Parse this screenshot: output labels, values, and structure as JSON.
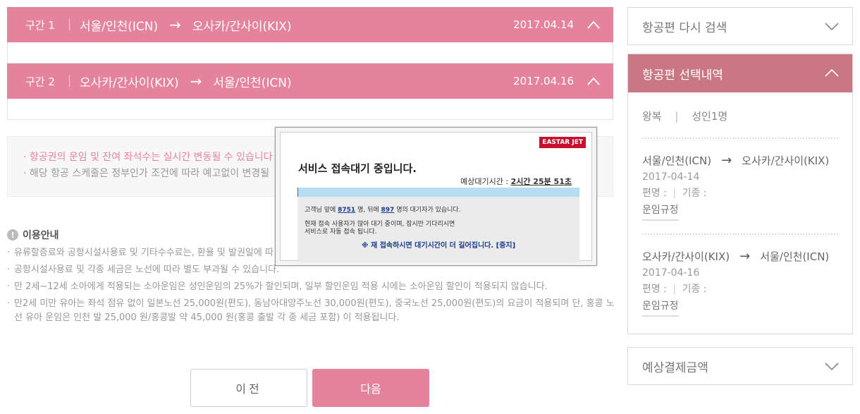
{
  "segments": [
    {
      "label": "구간 1",
      "from": "서울/인천(ICN)",
      "arrow": "→",
      "to": "오사카/간사이(KIX)",
      "date": "2017.04.14"
    },
    {
      "label": "구간 2",
      "from": "오사카/간사이(KIX)",
      "arrow": "→",
      "to": "서울/인천(ICN)",
      "date": "2017.04.16"
    }
  ],
  "notice": {
    "line1": "· 항공권의 운임 및 잔여 좌석수는 실시간 변동될 수 있습니다",
    "line2": "· 해당 항공 스케줄은 정부인가 조건에 따라 예고없이 변경될"
  },
  "guide": {
    "title": "이용안내",
    "items": [
      "유류할증료와 공항시설사용료 및 기타수수료는, 환율 및 발권일에 따",
      "공항시설사용료 및 각종 세금은 노선에 따라 별도 부과될 수 있습니다.",
      "만 2세~12세 소아에게 적용되는 소아운임은 성인운임의 25%가 할인되며, 일부 할인운임 적용 시에는 소아운임 할인이 적용되지 않습니다.",
      "만2세 미만 유아는 좌석 점유 없이 일본노선 25,000원(편도), 동남아대양주노선 30,000원(편도), 중국노선 25,000원(편도)의 요금이 적용되며 단, 홍콩 노선 유아 운임은 인천 발 25,000 원/홍콩발 약 45,000 원(홍콩 출발 각 종 세금 포함) 이 적용됩니다."
    ]
  },
  "buttons": {
    "prev": "이전",
    "next": "다음"
  },
  "sidebar": {
    "research": "항공편 다시 검색",
    "selection_title": "항공편 선택내역",
    "trip_type": "왕복",
    "passengers": "성인1명",
    "legs": [
      {
        "from": "서울/인천(ICN)",
        "arrow": "→",
        "to": "오사카/간사이(KIX)",
        "date": "2017-04-14",
        "flight": "편명 :",
        "aircraft": "기종 :",
        "fare_rules": "운임규정"
      },
      {
        "from": "오사카/간사이(KIX)",
        "arrow": "→",
        "to": "서울/인천(ICN)",
        "date": "2017-04-16",
        "flight": "편명 :",
        "aircraft": "기종 :",
        "fare_rules": "운임규정"
      }
    ],
    "estimate": "예상결제금액"
  },
  "popup": {
    "logo": "EASTAR JET",
    "title": "서비스 접속대기 중입니다.",
    "wait_label": "예상대기시간 :",
    "wait_value": "2시간 25분 51초",
    "progress": 0.001,
    "msg_prefix": "고객님 앞에",
    "ahead": "8751",
    "msg_mid": "명, 뒤에",
    "behind": "897",
    "msg_suffix": "명의 대기자가 있습니다.",
    "msg2": "현재 접속 사용자가 많아 대기 중이며, 잠시만 기다리시면",
    "msg3": "서비스로 자동 접속 됩니다.",
    "warning": "※ 재 접속하시면 대기시간이 더 길어집니다. [중지]"
  },
  "colors": {
    "accent": "#e5839d",
    "sidebar_active": "#c97883",
    "popup_blue": "#1a3b8c"
  }
}
